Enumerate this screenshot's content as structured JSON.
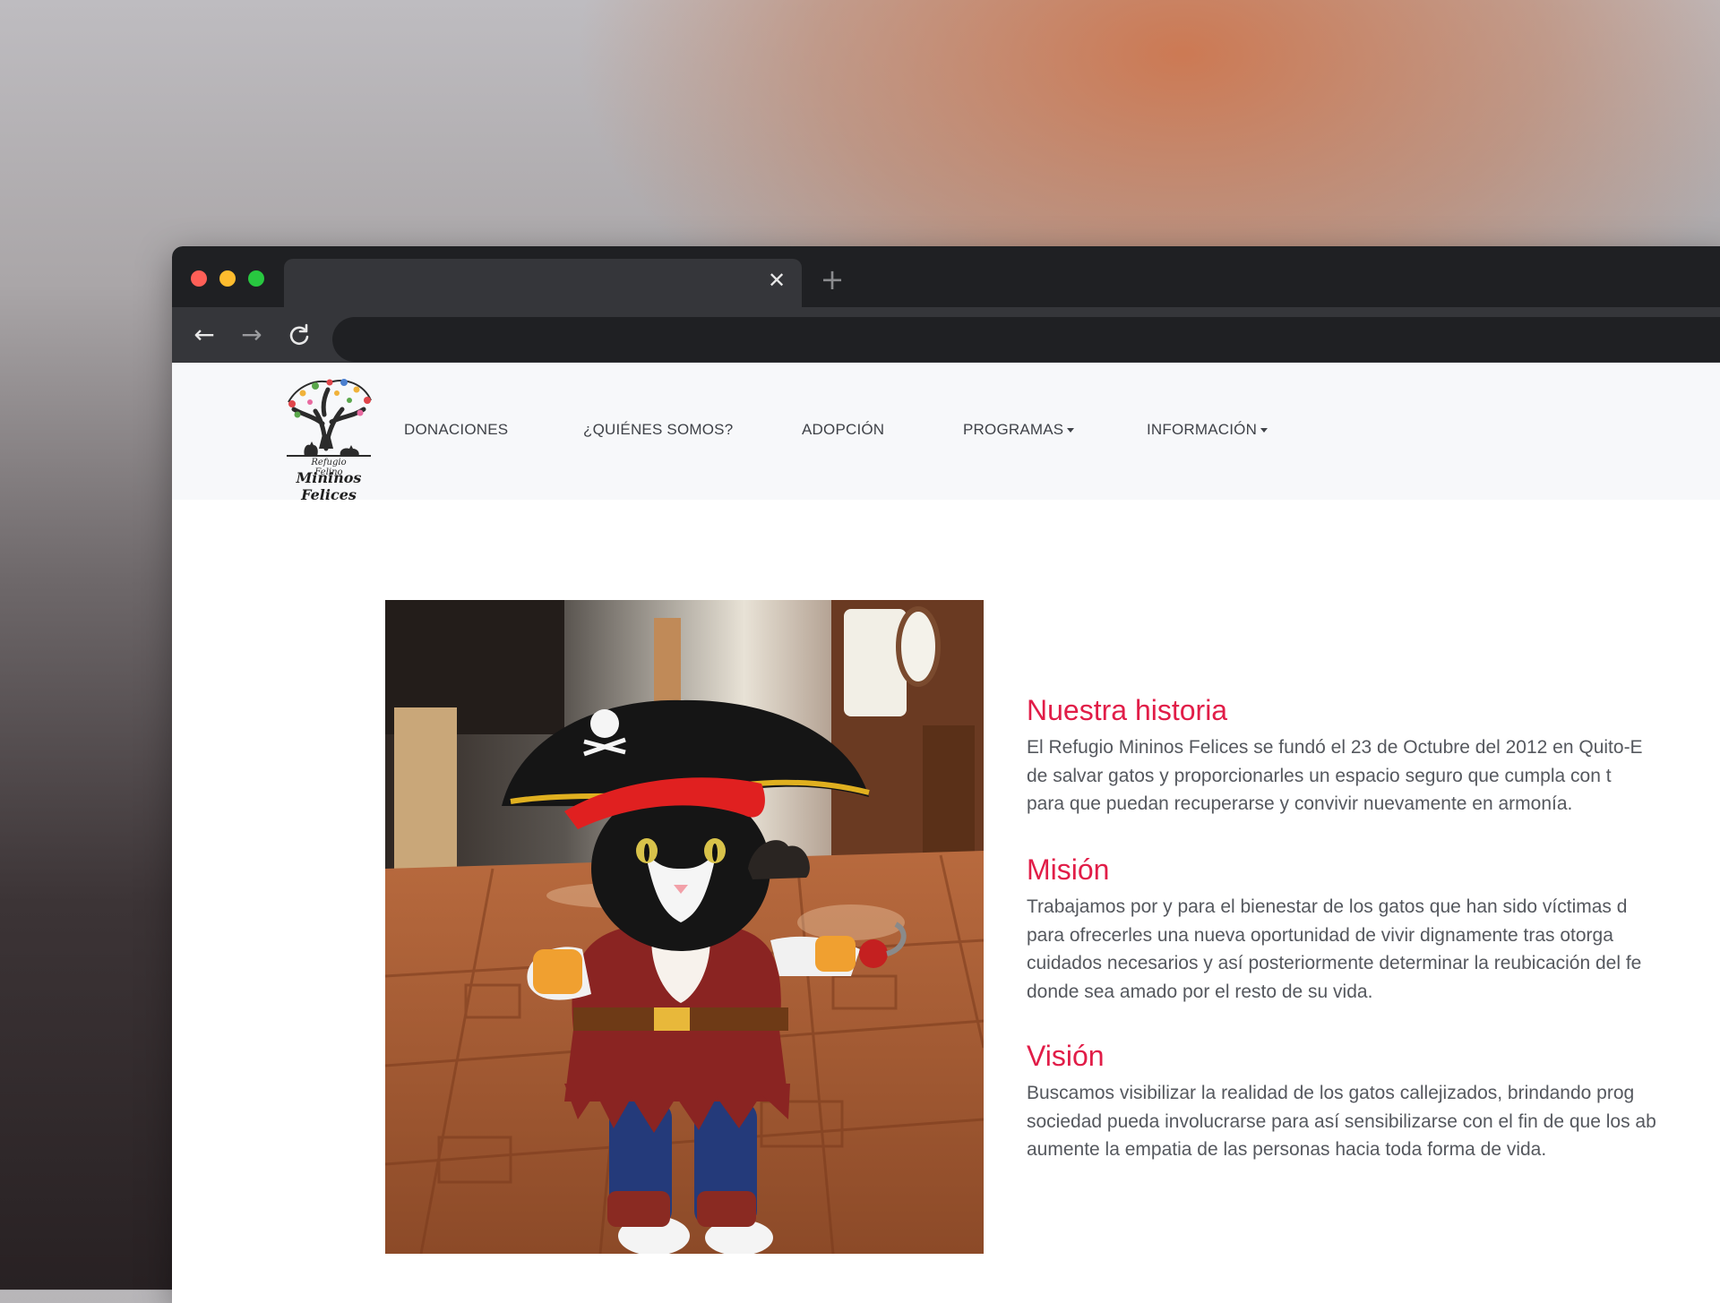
{
  "site": {
    "logo": {
      "line1": "Refugio Felino",
      "line2": "Mininos Felices"
    },
    "nav": [
      {
        "label": "DONACIONES",
        "dropdown": false
      },
      {
        "label": "¿QUIÉNES SOMOS?",
        "dropdown": false
      },
      {
        "label": "ADOPCIÓN",
        "dropdown": false
      },
      {
        "label": "PROGRAMAS",
        "dropdown": true
      },
      {
        "label": "INFORMACIÓN",
        "dropdown": true
      }
    ]
  },
  "browser": {
    "tab_close_icon": "close-icon",
    "new_tab_icon": "plus-icon",
    "nav_icons": [
      "arrow-left-icon",
      "arrow-right-icon",
      "reload-icon"
    ]
  },
  "sections": {
    "historia": {
      "title": "Nuestra historia",
      "lines": [
        "El Refugio Mininos Felices se fundó el 23 de Octubre del 2012 en Quito-E",
        "de salvar gatos y proporcionarles un espacio seguro que cumpla con t",
        "para que puedan recuperarse y convivir nuevamente en armonía."
      ]
    },
    "mision": {
      "title": "Misión",
      "lines": [
        "Trabajamos por y para el bienestar de los gatos que han sido víctimas d",
        "para ofrecerles una nueva oportunidad de vivir dignamente tras otorga",
        "cuidados necesarios y así posteriormente determinar la reubicación del fe",
        "donde sea amado por el resto de su vida."
      ]
    },
    "vision": {
      "title": "Visión",
      "lines": [
        "Buscamos visibilizar la realidad de los gatos callejizados, brindando prog",
        "sociedad pueda involucrarse para así sensibilizarse con el fin de que los ab",
        "aumente la empatia de las personas hacia toda forma de vida."
      ]
    }
  },
  "colors": {
    "accent": "#e11d48",
    "text": "#55585e",
    "nav_text": "#3f4248",
    "chrome_dark": "#1f2023",
    "chrome_tab": "#35363a"
  }
}
